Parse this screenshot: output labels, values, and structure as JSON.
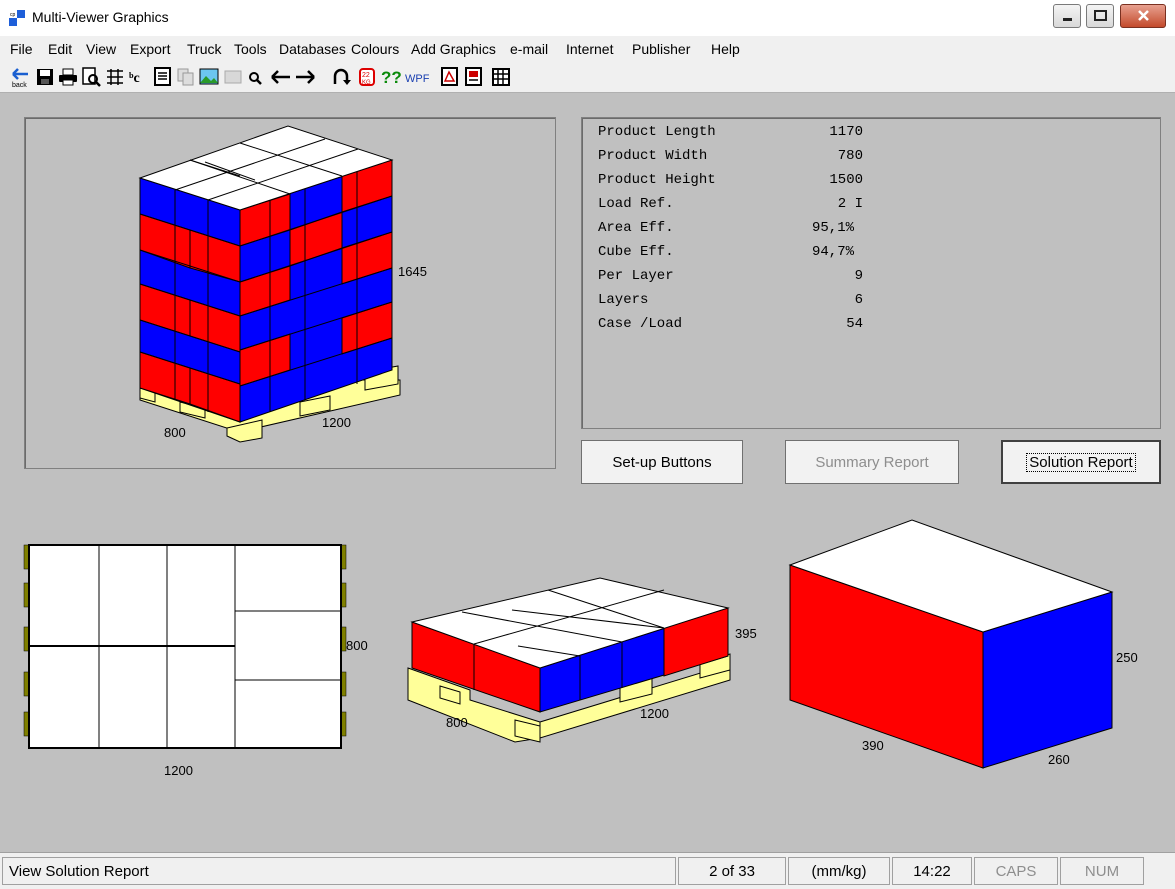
{
  "window": {
    "title": "Multi-Viewer Graphics"
  },
  "menu": [
    "File",
    "Edit",
    "View",
    "Export",
    "Truck",
    "Tools",
    "Databases",
    "Colours",
    "Add Graphics",
    "e-mail",
    "Internet",
    "Publisher",
    "Help"
  ],
  "toolbar": {
    "back_label": "back",
    "wpf_label": "WPF"
  },
  "colors": {
    "red": "#ff0000",
    "blue": "#0000ff",
    "pallet": "#ffff99",
    "bg": "#c0c0c0"
  },
  "info": {
    "rows": [
      {
        "label": "Product Length",
        "value": "1170"
      },
      {
        "label": "Product Width",
        "value": "780"
      },
      {
        "label": "Product Height",
        "value": "1500"
      },
      {
        "label": "Load Ref.",
        "value": "2 I"
      },
      {
        "label": "Area Eff.",
        "value": "95,1%"
      },
      {
        "label": "Cube Eff.",
        "value": "94,7%"
      },
      {
        "label": "Per Layer",
        "value": "9"
      },
      {
        "label": "Layers",
        "value": "6"
      },
      {
        "label": "Case /Load",
        "value": "54"
      }
    ]
  },
  "buttons": {
    "setup": "Set-up Buttons",
    "summary": "Summary Report",
    "solution": "Solution Report"
  },
  "views": {
    "load": {
      "height": "1645",
      "width": "800",
      "length": "1200"
    },
    "plan": {
      "length": "1200",
      "width": "800"
    },
    "layer": {
      "height": "395",
      "width": "800",
      "length": "1200"
    },
    "case": {
      "length": "390",
      "width": "260",
      "height": "250"
    }
  },
  "status": {
    "message": "View Solution Report",
    "page": "2 of 33",
    "units": "(mm/kg)",
    "time": "14:22",
    "caps": "CAPS",
    "num": "NUM"
  }
}
